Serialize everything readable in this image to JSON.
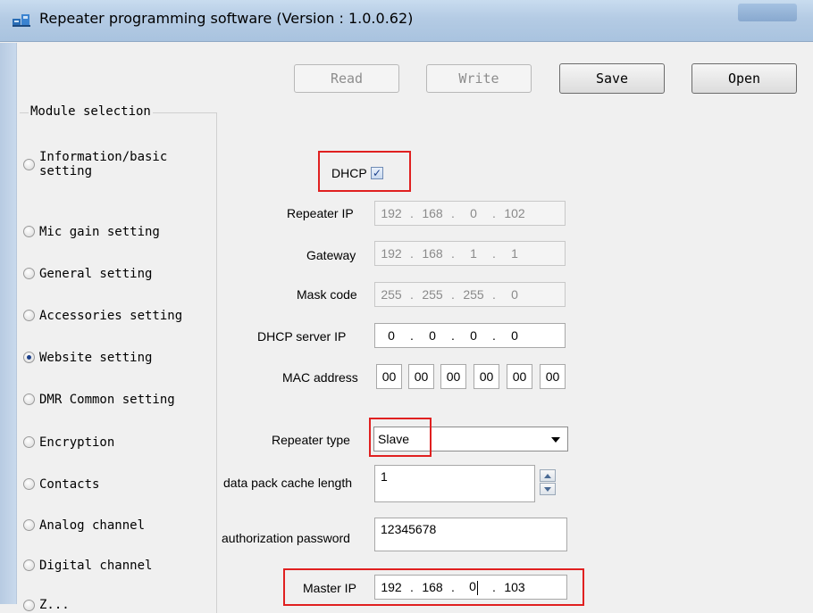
{
  "window": {
    "title": "Repeater programming software (Version : 1.0.0.62)"
  },
  "toolbar": {
    "read_label": "Read",
    "write_label": "Write",
    "save_label": "Save",
    "open_label": "Open"
  },
  "module_selection": {
    "title": "Module selection",
    "items": [
      {
        "label_line1": "Information/basic",
        "label_line2": "setting",
        "checked": false
      },
      {
        "label": "Mic gain setting",
        "checked": false
      },
      {
        "label": "General setting",
        "checked": false
      },
      {
        "label": "Accessories setting",
        "checked": false
      },
      {
        "label": "Website setting",
        "checked": true
      },
      {
        "label": "DMR Common setting",
        "checked": false
      },
      {
        "label": "Encryption",
        "checked": false
      },
      {
        "label": "Contacts",
        "checked": false
      },
      {
        "label": "Analog channel",
        "checked": false
      },
      {
        "label": "Digital channel",
        "checked": false
      },
      {
        "label": "Z...",
        "checked": false
      }
    ]
  },
  "form": {
    "dhcp": {
      "label": "DHCP",
      "checked": true,
      "mark": "✓"
    },
    "repeater_ip": {
      "label": "Repeater IP",
      "octets": [
        "192",
        "168",
        "0",
        "102"
      ]
    },
    "gateway": {
      "label": "Gateway",
      "octets": [
        "192",
        "168",
        "1",
        "1"
      ]
    },
    "mask_code": {
      "label": "Mask code",
      "octets": [
        "255",
        "255",
        "255",
        "0"
      ]
    },
    "dhcp_server_ip": {
      "label": "DHCP server IP",
      "octets": [
        "0",
        "0",
        "0",
        "0"
      ]
    },
    "mac_address": {
      "label": "MAC address",
      "bytes": [
        "00",
        "00",
        "00",
        "00",
        "00",
        "00"
      ]
    },
    "repeater_type": {
      "label": "Repeater type",
      "value": "Slave"
    },
    "data_pack_cache_length": {
      "label": "data pack cache length",
      "value": "1"
    },
    "authorization_password": {
      "label": "authorization password",
      "value": "12345678"
    },
    "master_ip": {
      "label": "Master IP",
      "octets": [
        "192",
        "168",
        "0",
        "103"
      ]
    },
    "ip_separator": "."
  },
  "colors": {
    "highlight_box": "#e02020",
    "titlebar": "#b4cbe4"
  }
}
